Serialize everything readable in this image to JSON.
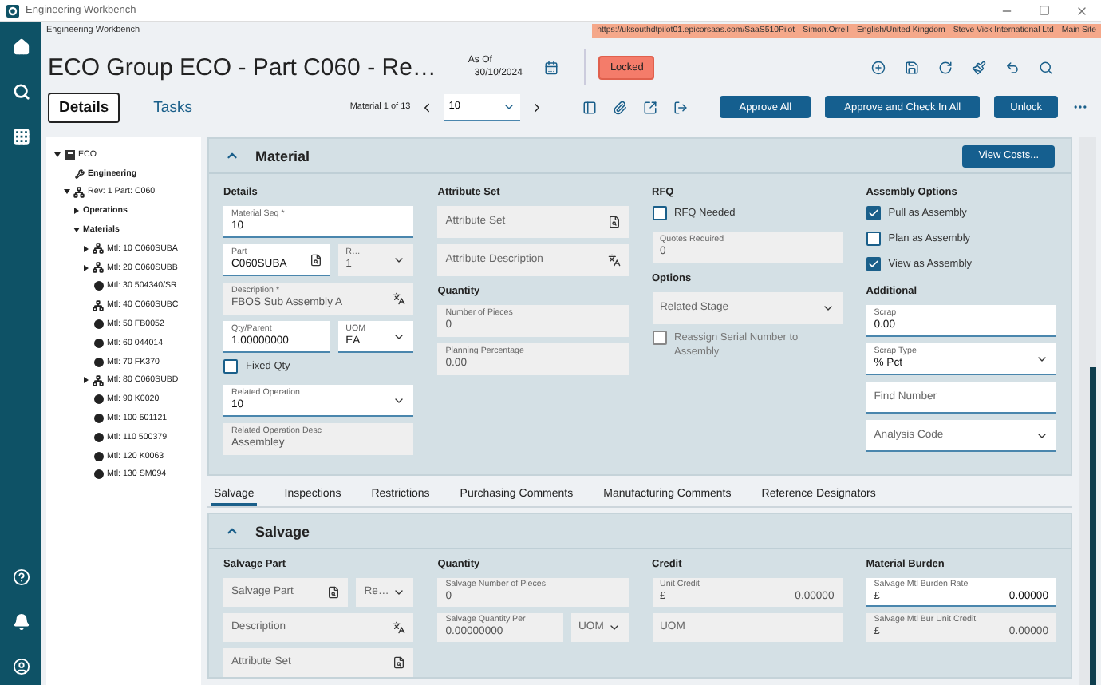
{
  "window": {
    "title": "Engineering Workbench"
  },
  "breadcrumb": "Engineering Workbench",
  "session_bar": [
    "https://uksouthdtpilot01.epicorsaas.com/SaaS510Pilot",
    "Simon.Orrell",
    "English/United Kingdom",
    "Steve Vick International Ltd",
    "Main Site"
  ],
  "header": {
    "title": "ECO Group ECO - Part C060 - Re…",
    "as_of_label": "As Of",
    "as_of_date": "30/10/2024",
    "status": "Locked"
  },
  "view_tabs": [
    {
      "label": "Details",
      "selected": true
    },
    {
      "label": "Tasks",
      "selected": false
    }
  ],
  "pager": {
    "label": "Material 1 of 13",
    "value": "10"
  },
  "actions": [
    "Approve All",
    "Approve and Check In All",
    "Unlock"
  ],
  "tree": [
    {
      "label": "ECO",
      "kind": "eco",
      "expanded": true,
      "children": [
        {
          "label": "Engineering",
          "kind": "engineering"
        },
        {
          "label": "Rev: 1 Part: C060",
          "kind": "revision",
          "expanded": true,
          "children": [
            {
              "label": "Operations",
              "kind": "folder",
              "expanded": false
            },
            {
              "label": "Materials",
              "kind": "folder",
              "expanded": true,
              "children": [
                {
                  "label": "Mtl: 10 C060SUBA",
                  "kind": "assembly",
                  "expanded": false
                },
                {
                  "label": "Mtl: 20 C060SUBB",
                  "kind": "assembly",
                  "expanded": false
                },
                {
                  "label": "Mtl: 30 504340/SR",
                  "kind": "part"
                },
                {
                  "label": "Mtl: 40 C060SUBC",
                  "kind": "assembly"
                },
                {
                  "label": "Mtl: 50 FB0052",
                  "kind": "part"
                },
                {
                  "label": "Mtl: 60 044014",
                  "kind": "part"
                },
                {
                  "label": "Mtl: 70 FK370",
                  "kind": "part"
                },
                {
                  "label": "Mtl: 80 C060SUBD",
                  "kind": "assembly",
                  "expanded": false
                },
                {
                  "label": "Mtl: 90 K0020",
                  "kind": "part"
                },
                {
                  "label": "Mtl: 100 501121",
                  "kind": "part"
                },
                {
                  "label": "Mtl: 110 500379",
                  "kind": "part"
                },
                {
                  "label": "Mtl: 120 K0063",
                  "kind": "part"
                },
                {
                  "label": "Mtl: 130 SM094",
                  "kind": "part"
                }
              ]
            }
          ]
        }
      ]
    }
  ],
  "material": {
    "title": "Material",
    "expanded": true,
    "button": "View Costs...",
    "columns": [
      {
        "groups": [
          {
            "heading": "Details",
            "items": [
              {
                "kind": "text",
                "label": "Material Seq *",
                "value": "10",
                "disabled": false
              },
              {
                "kind": "pair",
                "fields": [
                  {
                    "kind": "lookup",
                    "label": "Part",
                    "value": "C060SUBA",
                    "disabled": false
                  },
                  {
                    "kind": "select",
                    "label": "R…",
                    "value": "1",
                    "disabled": true
                  }
                ]
              },
              {
                "kind": "translate",
                "label": "Description *",
                "value": "FBOS Sub Assembly A",
                "disabled": true
              },
              {
                "kind": "pair",
                "fields": [
                  {
                    "kind": "text",
                    "label": "Qty/Parent",
                    "value": "1.00000000",
                    "disabled": false
                  },
                  {
                    "kind": "select",
                    "label": "UOM",
                    "value": "EA",
                    "disabled": false
                  }
                ]
              },
              {
                "kind": "checkbox",
                "label": "Fixed Qty",
                "checked": false,
                "disabled": false
              },
              {
                "kind": "select",
                "label": "Related Operation",
                "value": "10",
                "disabled": false
              },
              {
                "kind": "text",
                "label": "Related Operation Desc",
                "value": "Assembley",
                "disabled": true
              }
            ]
          }
        ]
      },
      {
        "groups": [
          {
            "heading": "Attribute Set",
            "items": [
              {
                "kind": "lookup",
                "placeholder": "Attribute Set",
                "disabled": true
              },
              {
                "kind": "translate",
                "placeholder": "Attribute Description",
                "disabled": true
              }
            ]
          },
          {
            "heading": "Quantity",
            "items": [
              {
                "kind": "text",
                "label": "Number of Pieces",
                "value": "0",
                "disabled": true
              },
              {
                "kind": "text",
                "label": "Planning Percentage",
                "value": "0.00",
                "disabled": true
              }
            ]
          }
        ]
      },
      {
        "groups": [
          {
            "heading": "RFQ",
            "items": [
              {
                "kind": "checkbox",
                "label": "RFQ Needed",
                "checked": false,
                "disabled": false
              },
              {
                "kind": "text",
                "label": "Quotes Required",
                "value": "0",
                "disabled": true
              }
            ]
          },
          {
            "heading": "Options",
            "items": [
              {
                "kind": "select",
                "placeholder": "Related Stage",
                "disabled": true
              },
              {
                "kind": "checkbox",
                "label": "Reassign Serial Number to Assembly",
                "checked": false,
                "disabled": true
              }
            ]
          }
        ]
      },
      {
        "groups": [
          {
            "heading": "Assembly Options",
            "items": [
              {
                "kind": "checkbox",
                "label": "Pull as Assembly",
                "checked": true,
                "disabled": false
              },
              {
                "kind": "checkbox",
                "label": "Plan as Assembly",
                "checked": false,
                "disabled": false
              },
              {
                "kind": "checkbox",
                "label": "View as Assembly",
                "checked": true,
                "disabled": false
              }
            ]
          },
          {
            "heading": "Additional",
            "items": [
              {
                "kind": "text",
                "label": "Scrap",
                "value": "0.00",
                "disabled": false
              },
              {
                "kind": "select",
                "label": "Scrap Type",
                "value": "% Pct",
                "disabled": false
              },
              {
                "kind": "text",
                "placeholder": "Find Number",
                "disabled": false
              },
              {
                "kind": "select",
                "placeholder": "Analysis Code",
                "disabled": false
              }
            ]
          }
        ]
      }
    ]
  },
  "detail_tabs": [
    {
      "label": "Salvage",
      "selected": true
    },
    {
      "label": "Inspections",
      "selected": false
    },
    {
      "label": "Restrictions",
      "selected": false
    },
    {
      "label": "Purchasing Comments",
      "selected": false
    },
    {
      "label": "Manufacturing Comments",
      "selected": false
    },
    {
      "label": "Reference Designators",
      "selected": false
    }
  ],
  "salvage": {
    "title": "Salvage",
    "expanded": true,
    "columns": [
      {
        "groups": [
          {
            "heading": "Salvage Part",
            "items": [
              {
                "kind": "pair",
                "fields": [
                  {
                    "kind": "lookup",
                    "placeholder": "Salvage Part",
                    "disabled": true
                  },
                  {
                    "kind": "select",
                    "placeholder": "Re…",
                    "disabled": true
                  }
                ]
              },
              {
                "kind": "translate",
                "placeholder": "Description",
                "disabled": true
              },
              {
                "kind": "lookup",
                "placeholder": "Attribute Set",
                "disabled": true
              }
            ]
          }
        ]
      },
      {
        "groups": [
          {
            "heading": "Quantity",
            "items": [
              {
                "kind": "text",
                "label": "Salvage Number of Pieces",
                "value": "0",
                "disabled": true
              },
              {
                "kind": "pair",
                "fields": [
                  {
                    "kind": "text",
                    "label": "Salvage Quantity Per",
                    "value": "0.00000000",
                    "disabled": true
                  },
                  {
                    "kind": "select",
                    "placeholder": "UOM",
                    "disabled": true
                  }
                ]
              }
            ]
          }
        ]
      },
      {
        "groups": [
          {
            "heading": "Credit",
            "items": [
              {
                "kind": "currency",
                "label": "Unit Credit",
                "prefix": "£",
                "value": "0.00000",
                "disabled": true
              },
              {
                "kind": "text",
                "placeholder": "UOM",
                "disabled": true
              }
            ]
          }
        ]
      },
      {
        "groups": [
          {
            "heading": "Material Burden",
            "items": [
              {
                "kind": "currency",
                "label": "Salvage Mtl Burden Rate",
                "prefix": "£",
                "value": "0.00000",
                "disabled": false
              },
              {
                "kind": "currency",
                "label": "Salvage Mtl Bur Unit Credit",
                "prefix": "£",
                "value": "0.00000",
                "disabled": true
              }
            ]
          }
        ]
      }
    ]
  }
}
